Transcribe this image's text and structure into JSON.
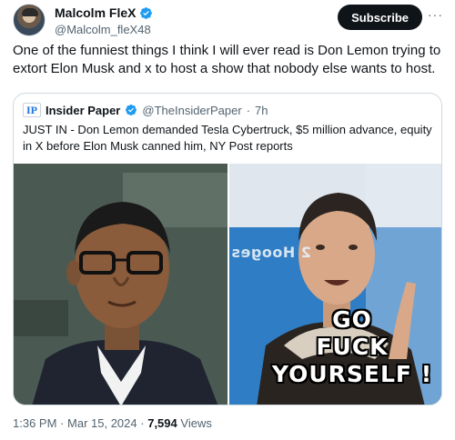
{
  "header": {
    "display_name": "Malcolm FleX",
    "handle": "@Malcolm_fleX48",
    "subscribe_label": "Subscribe",
    "verified_icon": "verified-badge-icon",
    "more_icon": "more-options-icon",
    "more_glyph": "···"
  },
  "tweet": {
    "text": "One of the funniest things I think I will ever read is Don Lemon trying to extort Elon Musk and x to host a show that nobody else wants to host."
  },
  "quote": {
    "logo_text": "IP",
    "name": "Insider Paper",
    "handle": "@TheInsiderPaper",
    "separator": "·",
    "time": "7h",
    "text": "JUST IN - Don Lemon demanded Tesla Cybertruck, $5 million advance, equity in X before Elon Musk canned him, NY Post reports",
    "image_right": {
      "sign_text": "2 Hooges",
      "meme_lines": [
        "GO",
        "FUCK",
        "YOURSELF !"
      ]
    }
  },
  "meta": {
    "time": "1:36 PM",
    "dot": "·",
    "date": "Mar 15, 2024",
    "dot2": "·",
    "views_count": "7,594",
    "views_label": "Views"
  },
  "colors": {
    "text": "#0f1419",
    "secondary": "#536471",
    "verified": "#1d9bf0",
    "border": "#cfd9de"
  }
}
